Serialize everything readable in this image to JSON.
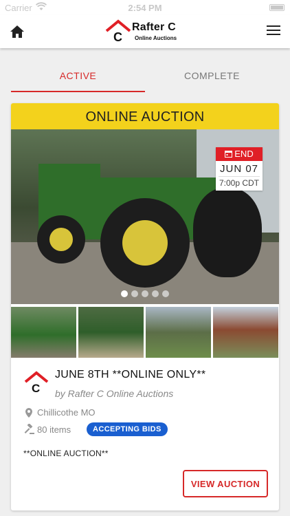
{
  "status_bar": {
    "carrier": "Carrier",
    "time": "2:54 PM"
  },
  "header": {
    "brand_name": "Rafter C",
    "brand_tagline": "Online Auctions",
    "logo_letter": "C"
  },
  "tabs": [
    {
      "label": "ACTIVE",
      "active": true
    },
    {
      "label": "COMPLETE",
      "active": false
    }
  ],
  "auction": {
    "banner": "ONLINE AUCTION",
    "end": {
      "label": "END",
      "date": "JUN 07",
      "time": "7:00p CDT"
    },
    "carousel": {
      "total": 5,
      "active_index": 0
    },
    "title": "JUNE 8TH **ONLINE ONLY**",
    "by": "by Rafter C Online Auctions",
    "location": "Chillicothe MO",
    "items_count": "80 items",
    "status_badge": "ACCEPTING BIDS",
    "description": "**ONLINE AUCTION**",
    "view_button": "VIEW AUCTION"
  },
  "colors": {
    "accent_red": "#d62828",
    "banner_yellow": "#f3d21c",
    "badge_blue": "#1a5fd0"
  }
}
